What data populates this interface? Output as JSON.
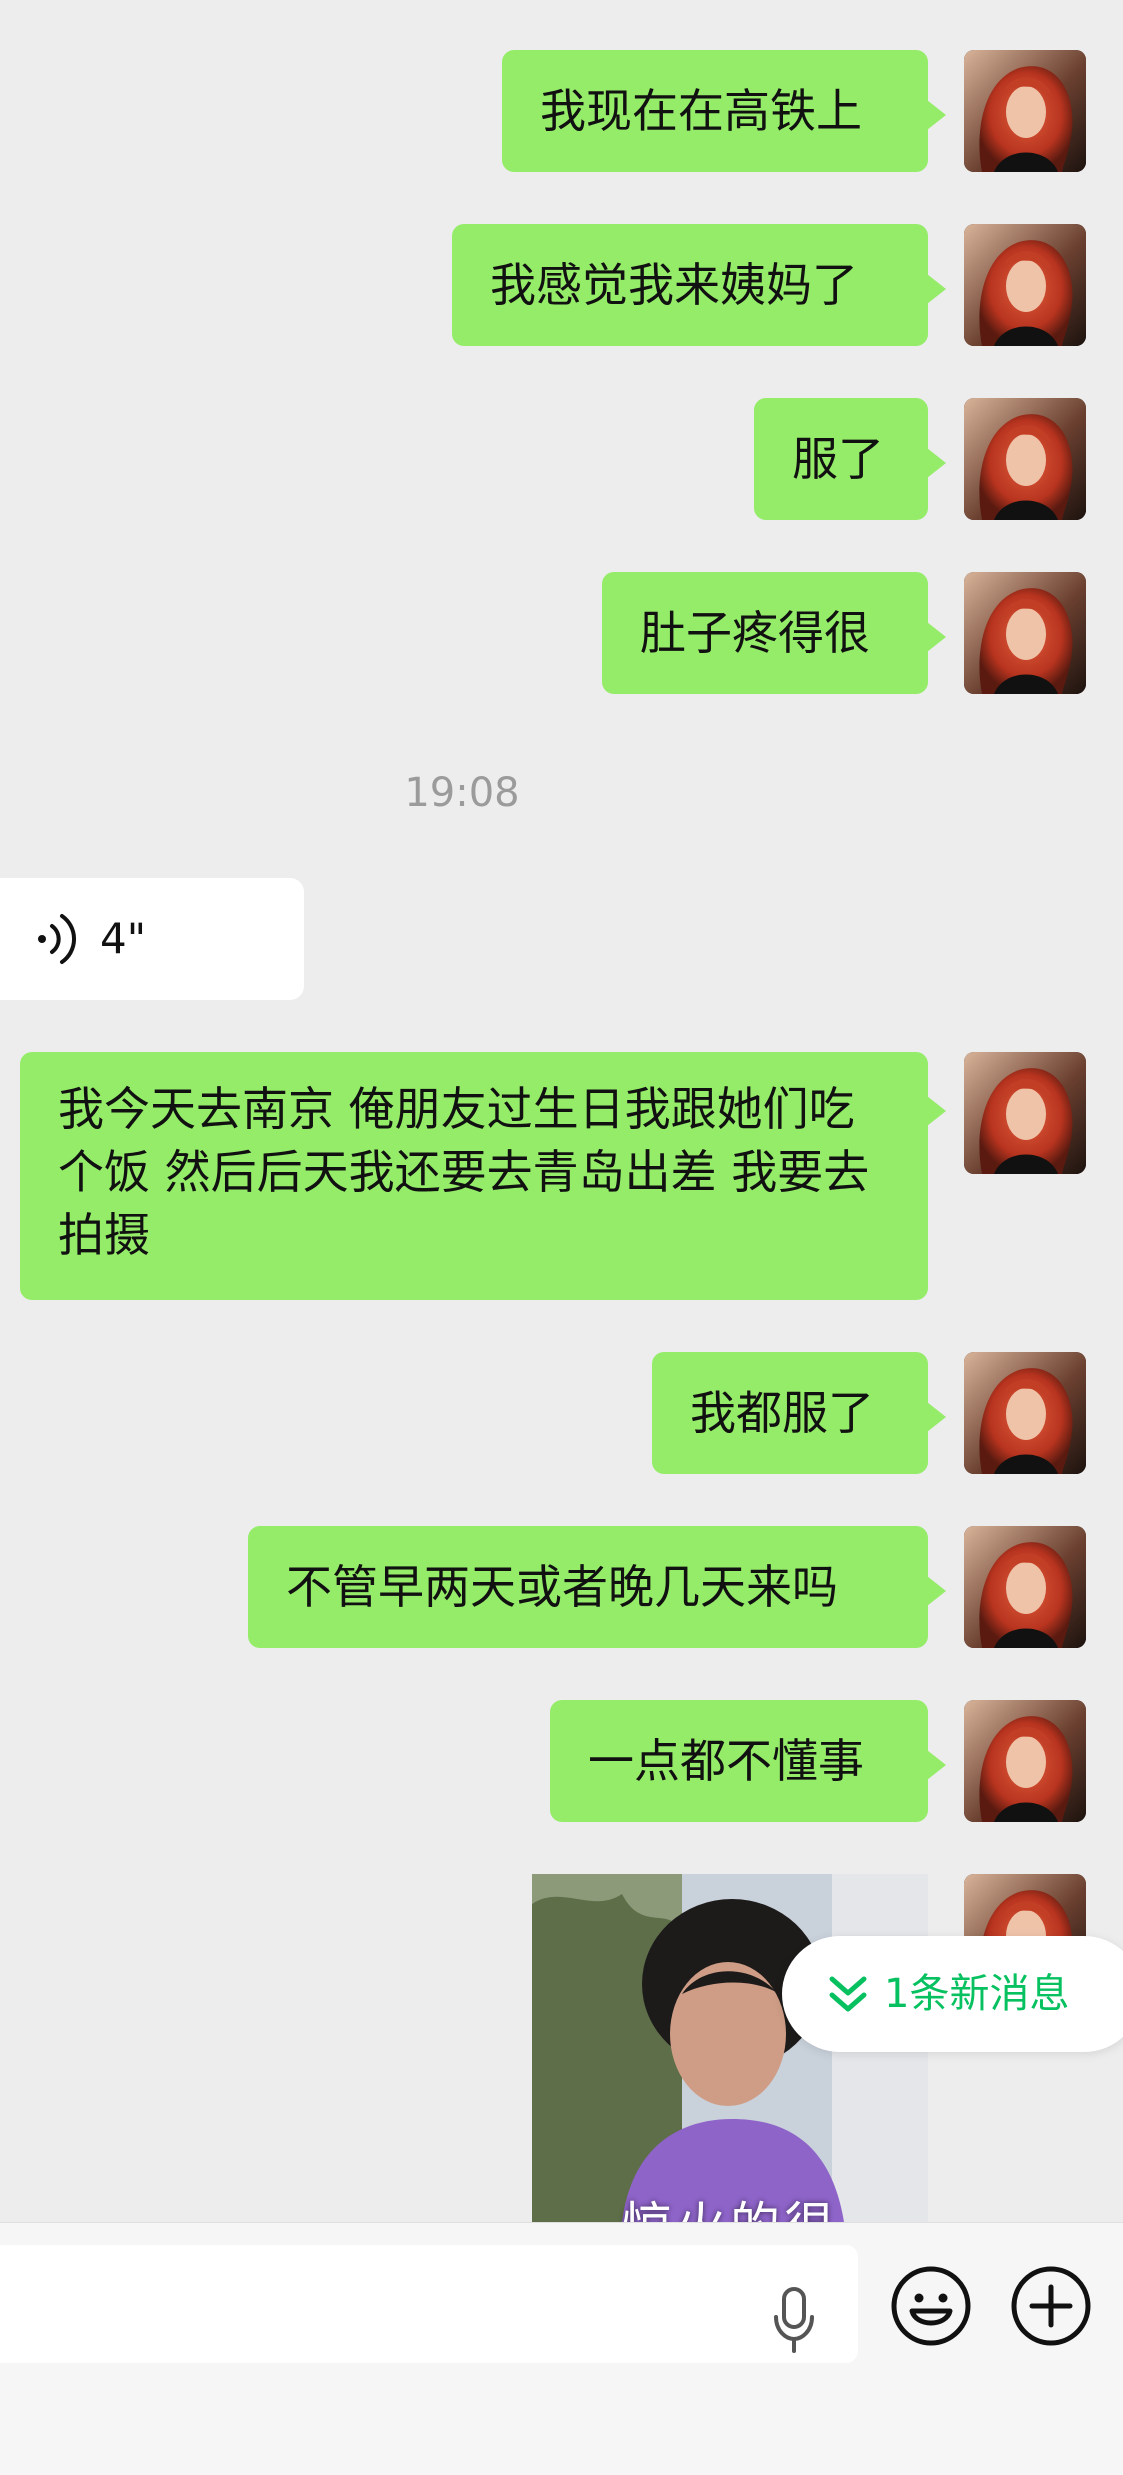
{
  "messages": [
    {
      "id": "m1",
      "side": "right",
      "text": "我现在在高铁上"
    },
    {
      "id": "m2",
      "side": "right",
      "text": "我感觉我来姨妈了"
    },
    {
      "id": "m3",
      "side": "right",
      "text": "服了"
    },
    {
      "id": "m4",
      "side": "right",
      "text": "肚子疼得很"
    },
    {
      "id": "m5",
      "side": "right",
      "text": "我今天去南京 俺朋友过生日我跟她们吃个饭 然后后天我还要去青岛出差 我要去拍摄"
    },
    {
      "id": "m6",
      "side": "right",
      "text": "我都服了"
    },
    {
      "id": "m7",
      "side": "right",
      "text": "不管早两天或者晚几天来吗"
    },
    {
      "id": "m8",
      "side": "right",
      "text": "一点都不懂事"
    }
  ],
  "timestamp": "19:08",
  "voice_message": {
    "duration": "4\"",
    "icon": "voice-wave-icon"
  },
  "sticker": {
    "caption": "惊火的很"
  },
  "new_message_pill": {
    "text": "1条新消息",
    "icon": "double-chevron-down-icon",
    "color": "#07c160"
  },
  "input_bar": {
    "icons": [
      "microphone-icon",
      "emoji-icon",
      "plus-icon"
    ]
  },
  "colors": {
    "background": "#ededed",
    "self_bubble": "#95ec69",
    "other_bubble": "#ffffff",
    "accent": "#07c160"
  }
}
